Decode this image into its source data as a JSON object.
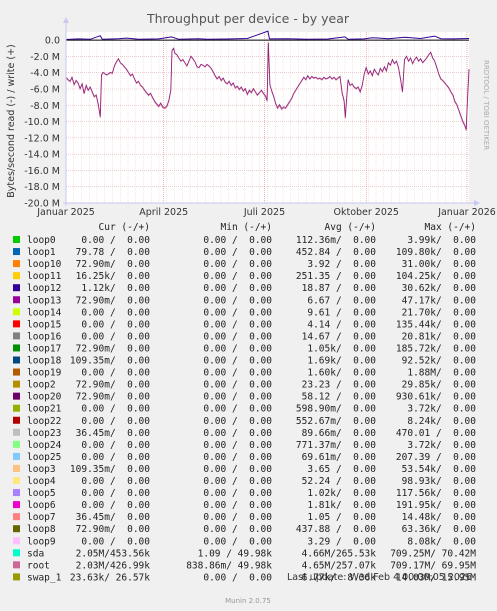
{
  "chart_data": {
    "type": "line",
    "title": "Throughput per device - by year",
    "ylabel": "Bytes/second read (-) / write (+)",
    "side_label": "RRDTOOL / TOBI OETIKER",
    "ylim": [
      -20000000,
      1000000
    ],
    "y_ticks": [
      {
        "v": 0,
        "label": "0.0"
      },
      {
        "v": -2000000,
        "label": "-2.0 M"
      },
      {
        "v": -4000000,
        "label": "-4.0 M"
      },
      {
        "v": -6000000,
        "label": "-6.0 M"
      },
      {
        "v": -8000000,
        "label": "-8.0 M"
      },
      {
        "v": -10000000,
        "label": "-10.0 M"
      },
      {
        "v": -12000000,
        "label": "-12.0 M"
      },
      {
        "v": -14000000,
        "label": "-14.0 M"
      },
      {
        "v": -16000000,
        "label": "-16.0 M"
      },
      {
        "v": -18000000,
        "label": "-18.0 M"
      },
      {
        "v": -20000000,
        "label": "-20.0 M"
      }
    ],
    "x_ticks": [
      {
        "t": 0.0,
        "label": "Januar 2025"
      },
      {
        "t": 0.2425,
        "label": "April 2025"
      },
      {
        "t": 0.4925,
        "label": "Juli 2025"
      },
      {
        "t": 0.745,
        "label": "Oktober 2025"
      },
      {
        "t": 0.995,
        "label": "Januar 2026"
      }
    ],
    "columns": [
      "",
      "Cur (-/+)",
      "Min (-/+)",
      "Avg (-/+)",
      "Max (-/+)"
    ],
    "series": [
      {
        "name": "loop0",
        "color": "#00cc00",
        "cur": "0.00 /  0.00",
        "min": "0.00 /  0.00",
        "avg": "112.36m/  0.00",
        "max": "3.99k/  0.00"
      },
      {
        "name": "loop1",
        "color": "#0066b3",
        "cur": "79.78 /  0.00",
        "min": "0.00 /  0.00",
        "avg": "452.84 /  0.00",
        "max": "109.80k/  0.00"
      },
      {
        "name": "loop10",
        "color": "#ff8000",
        "cur": "72.90m/  0.00",
        "min": "0.00 /  0.00",
        "avg": "3.92 /  0.00",
        "max": "31.00k/  0.00"
      },
      {
        "name": "loop11",
        "color": "#ffcc00",
        "cur": "16.25k/  0.00",
        "min": "0.00 /  0.00",
        "avg": "251.35 /  0.00",
        "max": "104.25k/  0.00"
      },
      {
        "name": "loop12",
        "color": "#330099",
        "cur": "1.12k/  0.00",
        "min": "0.00 /  0.00",
        "avg": "18.87 /  0.00",
        "max": "30.62k/  0.00"
      },
      {
        "name": "loop13",
        "color": "#990099",
        "cur": "72.90m/  0.00",
        "min": "0.00 /  0.00",
        "avg": "6.67 /  0.00",
        "max": "47.17k/  0.00"
      },
      {
        "name": "loop14",
        "color": "#ccff00",
        "cur": "0.00 /  0.00",
        "min": "0.00 /  0.00",
        "avg": "9.61 /  0.00",
        "max": "21.70k/  0.00"
      },
      {
        "name": "loop15",
        "color": "#ff0000",
        "cur": "0.00 /  0.00",
        "min": "0.00 /  0.00",
        "avg": "4.14 /  0.00",
        "max": "135.44k/  0.00"
      },
      {
        "name": "loop16",
        "color": "#808080",
        "cur": "0.00 /  0.00",
        "min": "0.00 /  0.00",
        "avg": "14.67 /  0.00",
        "max": "20.81k/  0.00"
      },
      {
        "name": "loop17",
        "color": "#008f00",
        "cur": "72.90m/  0.00",
        "min": "0.00 /  0.00",
        "avg": "1.05k/  0.00",
        "max": "185.72k/  0.00"
      },
      {
        "name": "loop18",
        "color": "#00487d",
        "cur": "109.35m/  0.00",
        "min": "0.00 /  0.00",
        "avg": "1.69k/  0.00",
        "max": "92.52k/  0.00"
      },
      {
        "name": "loop19",
        "color": "#b35a00",
        "cur": "0.00 /  0.00",
        "min": "0.00 /  0.00",
        "avg": "1.60k/  0.00",
        "max": "1.88M/  0.00"
      },
      {
        "name": "loop2",
        "color": "#b38f00",
        "cur": "72.90m/  0.00",
        "min": "0.00 /  0.00",
        "avg": "23.23 /  0.00",
        "max": "29.85k/  0.00"
      },
      {
        "name": "loop20",
        "color": "#6b006b",
        "cur": "72.90m/  0.00",
        "min": "0.00 /  0.00",
        "avg": "58.12 /  0.00",
        "max": "930.61k/  0.00"
      },
      {
        "name": "loop21",
        "color": "#8fb300",
        "cur": "0.00 /  0.00",
        "min": "0.00 /  0.00",
        "avg": "598.90m/  0.00",
        "max": "3.72k/  0.00"
      },
      {
        "name": "loop22",
        "color": "#b30000",
        "cur": "0.00 /  0.00",
        "min": "0.00 /  0.00",
        "avg": "552.67m/  0.00",
        "max": "8.24k/  0.00"
      },
      {
        "name": "loop23",
        "color": "#bebebe",
        "cur": "36.45m/  0.00",
        "min": "0.00 /  0.00",
        "avg": "89.66m/  0.00",
        "max": "470.01 /  0.00"
      },
      {
        "name": "loop24",
        "color": "#80ff80",
        "cur": "0.00 /  0.00",
        "min": "0.00 /  0.00",
        "avg": "771.37m/  0.00",
        "max": "3.72k/  0.00"
      },
      {
        "name": "loop25",
        "color": "#80c9ff",
        "cur": "0.00 /  0.00",
        "min": "0.00 /  0.00",
        "avg": "69.61m/  0.00",
        "max": "207.39 /  0.00"
      },
      {
        "name": "loop3",
        "color": "#ffc080",
        "cur": "109.35m/  0.00",
        "min": "0.00 /  0.00",
        "avg": "3.65 /  0.00",
        "max": "53.54k/  0.00"
      },
      {
        "name": "loop4",
        "color": "#ffe680",
        "cur": "0.00 /  0.00",
        "min": "0.00 /  0.00",
        "avg": "52.24 /  0.00",
        "max": "98.93k/  0.00"
      },
      {
        "name": "loop5",
        "color": "#aa80ff",
        "cur": "0.00 /  0.00",
        "min": "0.00 /  0.00",
        "avg": "1.02k/  0.00",
        "max": "117.56k/  0.00"
      },
      {
        "name": "loop6",
        "color": "#ee00cc",
        "cur": "0.00 /  0.00",
        "min": "0.00 /  0.00",
        "avg": "1.81k/  0.00",
        "max": "191.95k/  0.00"
      },
      {
        "name": "loop7",
        "color": "#ff8080",
        "cur": "36.45m/  0.00",
        "min": "0.00 /  0.00",
        "avg": "1.05 /  0.00",
        "max": "14.48k/  0.00"
      },
      {
        "name": "loop8",
        "color": "#666600",
        "cur": "72.90m/  0.00",
        "min": "0.00 /  0.00",
        "avg": "437.88 /  0.00",
        "max": "63.36k/  0.00"
      },
      {
        "name": "loop9",
        "color": "#ffbfff",
        "cur": "0.00 /  0.00",
        "min": "0.00 /  0.00",
        "avg": "3.29 /  0.00",
        "max": "8.08k/  0.00"
      },
      {
        "name": "sda",
        "color": "#00ffcc",
        "cur": "2.05M/453.56k",
        "min": "1.09 / 49.98k",
        "avg": "4.66M/265.53k",
        "max": "709.25M/ 70.42M"
      },
      {
        "name": "root",
        "color": "#cc6699",
        "cur": "2.03M/426.99k",
        "min": "838.86m/ 49.98k",
        "avg": "4.65M/257.07k",
        "max": "709.17M/ 69.95M"
      },
      {
        "name": "swap_1",
        "color": "#999900",
        "cur": "23.63k/ 26.57k",
        "min": "0.00 /  0.00",
        "avg": "6.77k/  8.36k",
        "max": "14.03M/ 15.95M"
      }
    ],
    "read_trace": [
      [
        0.0,
        -4.6
      ],
      [
        0.005,
        -4.9
      ],
      [
        0.01,
        -5.1
      ],
      [
        0.015,
        -4.6
      ],
      [
        0.02,
        -5.5
      ],
      [
        0.025,
        -5.0
      ],
      [
        0.03,
        -5.3
      ],
      [
        0.035,
        -6.0
      ],
      [
        0.04,
        -5.4
      ],
      [
        0.045,
        -6.6
      ],
      [
        0.05,
        -5.6
      ],
      [
        0.055,
        -6.2
      ],
      [
        0.06,
        -5.8
      ],
      [
        0.065,
        -6.4
      ],
      [
        0.07,
        -7.0
      ],
      [
        0.075,
        -6.8
      ],
      [
        0.08,
        -7.9
      ],
      [
        0.085,
        -9.5
      ],
      [
        0.088,
        -4.3
      ],
      [
        0.092,
        -4.0
      ],
      [
        0.095,
        -4.1
      ],
      [
        0.1,
        -4.3
      ],
      [
        0.105,
        -4.2
      ],
      [
        0.11,
        -4.0
      ],
      [
        0.115,
        -4.1
      ],
      [
        0.12,
        -3.2
      ],
      [
        0.125,
        -2.7
      ],
      [
        0.13,
        -2.3
      ],
      [
        0.135,
        -2.8
      ],
      [
        0.14,
        -3.0
      ],
      [
        0.145,
        -3.3
      ],
      [
        0.15,
        -3.6
      ],
      [
        0.155,
        -4.0
      ],
      [
        0.16,
        -4.4
      ],
      [
        0.165,
        -4.2
      ],
      [
        0.17,
        -4.8
      ],
      [
        0.175,
        -5.3
      ],
      [
        0.18,
        -5.1
      ],
      [
        0.185,
        -5.6
      ],
      [
        0.19,
        -5.8
      ],
      [
        0.195,
        -6.2
      ],
      [
        0.2,
        -6.5
      ],
      [
        0.205,
        -6.8
      ],
      [
        0.21,
        -6.6
      ],
      [
        0.215,
        -7.1
      ],
      [
        0.22,
        -7.6
      ],
      [
        0.225,
        -7.9
      ],
      [
        0.23,
        -8.2
      ],
      [
        0.235,
        -7.8
      ],
      [
        0.24,
        -8.3
      ],
      [
        0.245,
        -8.4
      ],
      [
        0.25,
        -8.2
      ],
      [
        0.255,
        -7.5
      ],
      [
        0.26,
        -6.2
      ],
      [
        0.263,
        -1.3
      ],
      [
        0.267,
        -1.0
      ],
      [
        0.27,
        -1.6
      ],
      [
        0.275,
        -1.8
      ],
      [
        0.28,
        -2.2
      ],
      [
        0.285,
        -2.6
      ],
      [
        0.29,
        -2.4
      ],
      [
        0.295,
        -2.8
      ],
      [
        0.3,
        -3.2
      ],
      [
        0.305,
        -2.6
      ],
      [
        0.31,
        -2.0
      ],
      [
        0.315,
        -2.3
      ],
      [
        0.32,
        -2.7
      ],
      [
        0.325,
        -3.3
      ],
      [
        0.33,
        -3.4
      ],
      [
        0.335,
        -3.0
      ],
      [
        0.34,
        -3.1
      ],
      [
        0.345,
        -3.3
      ],
      [
        0.35,
        -3.0
      ],
      [
        0.355,
        -3.2
      ],
      [
        0.36,
        -3.5
      ],
      [
        0.365,
        -3.9
      ],
      [
        0.37,
        -4.4
      ],
      [
        0.375,
        -4.8
      ],
      [
        0.38,
        -4.5
      ],
      [
        0.385,
        -5.0
      ],
      [
        0.39,
        -4.7
      ],
      [
        0.395,
        -5.2
      ],
      [
        0.4,
        -5.4
      ],
      [
        0.405,
        -5.1
      ],
      [
        0.41,
        -5.6
      ],
      [
        0.415,
        -5.3
      ],
      [
        0.42,
        -5.9
      ],
      [
        0.425,
        -5.7
      ],
      [
        0.43,
        -6.1
      ],
      [
        0.435,
        -5.8
      ],
      [
        0.44,
        -6.3
      ],
      [
        0.445,
        -6.0
      ],
      [
        0.45,
        -6.7
      ],
      [
        0.455,
        -6.2
      ],
      [
        0.46,
        -6.5
      ],
      [
        0.465,
        -6.0
      ],
      [
        0.47,
        -6.4
      ],
      [
        0.475,
        -6.8
      ],
      [
        0.48,
        -6.5
      ],
      [
        0.485,
        -6.2
      ],
      [
        0.49,
        -6.6
      ],
      [
        0.495,
        -6.9
      ],
      [
        0.499,
        -7.5
      ],
      [
        0.502,
        -0.3
      ],
      [
        0.506,
        -5.5
      ],
      [
        0.51,
        -6.2
      ],
      [
        0.515,
        -6.9
      ],
      [
        0.52,
        -7.8
      ],
      [
        0.525,
        -8.4
      ],
      [
        0.53,
        -8.0
      ],
      [
        0.535,
        -8.5
      ],
      [
        0.54,
        -8.3
      ],
      [
        0.545,
        -8.4
      ],
      [
        0.55,
        -8.0
      ],
      [
        0.555,
        -7.6
      ],
      [
        0.56,
        -7.2
      ],
      [
        0.565,
        -6.6
      ],
      [
        0.57,
        -6.2
      ],
      [
        0.575,
        -5.8
      ],
      [
        0.58,
        -5.4
      ],
      [
        0.585,
        -5.0
      ],
      [
        0.59,
        -4.6
      ],
      [
        0.595,
        -4.9
      ],
      [
        0.6,
        -4.4
      ],
      [
        0.605,
        -4.8
      ],
      [
        0.61,
        -4.5
      ],
      [
        0.615,
        -4.7
      ],
      [
        0.62,
        -4.6
      ],
      [
        0.625,
        -4.8
      ],
      [
        0.63,
        -4.7
      ],
      [
        0.635,
        -4.9
      ],
      [
        0.64,
        -4.6
      ],
      [
        0.645,
        -4.8
      ],
      [
        0.65,
        -4.7
      ],
      [
        0.655,
        -4.5
      ],
      [
        0.66,
        -4.8
      ],
      [
        0.665,
        -4.6
      ],
      [
        0.67,
        -4.9
      ],
      [
        0.675,
        -4.7
      ],
      [
        0.68,
        -4.5
      ],
      [
        0.685,
        -6.5
      ],
      [
        0.69,
        -7.5
      ],
      [
        0.693,
        -9.6
      ],
      [
        0.697,
        -6.8
      ],
      [
        0.7,
        -4.9
      ],
      [
        0.705,
        -5.6
      ],
      [
        0.71,
        -5.4
      ],
      [
        0.715,
        -5.8
      ],
      [
        0.72,
        -6.0
      ],
      [
        0.725,
        -5.8
      ],
      [
        0.73,
        -6.4
      ],
      [
        0.735,
        -5.6
      ],
      [
        0.74,
        -4.2
      ],
      [
        0.745,
        -3.4
      ],
      [
        0.75,
        -4.2
      ],
      [
        0.755,
        -3.8
      ],
      [
        0.76,
        -4.4
      ],
      [
        0.765,
        -3.6
      ],
      [
        0.77,
        -4.0
      ],
      [
        0.775,
        -4.3
      ],
      [
        0.78,
        -3.5
      ],
      [
        0.785,
        -3.9
      ],
      [
        0.79,
        -3.3
      ],
      [
        0.795,
        -3.8
      ],
      [
        0.8,
        -2.8
      ],
      [
        0.805,
        -3.1
      ],
      [
        0.81,
        -2.4
      ],
      [
        0.815,
        -2.9
      ],
      [
        0.82,
        -2.6
      ],
      [
        0.825,
        -3.4
      ],
      [
        0.83,
        -4.8
      ],
      [
        0.835,
        -6.4
      ],
      [
        0.84,
        -2.4
      ],
      [
        0.845,
        -2.0
      ],
      [
        0.85,
        -2.6
      ],
      [
        0.855,
        -2.2
      ],
      [
        0.86,
        -2.9
      ],
      [
        0.865,
        -2.4
      ],
      [
        0.87,
        -2.1
      ],
      [
        0.875,
        -2.6
      ],
      [
        0.88,
        -2.3
      ],
      [
        0.885,
        -2.8
      ],
      [
        0.89,
        -2.5
      ],
      [
        0.895,
        -2.2
      ],
      [
        0.9,
        -1.8
      ],
      [
        0.905,
        -1.5
      ],
      [
        0.91,
        -2.2
      ],
      [
        0.915,
        -2.6
      ],
      [
        0.92,
        -3.4
      ],
      [
        0.925,
        -4.2
      ],
      [
        0.93,
        -4.8
      ],
      [
        0.935,
        -5.0
      ],
      [
        0.94,
        -5.3
      ],
      [
        0.945,
        -5.6
      ],
      [
        0.95,
        -5.9
      ],
      [
        0.955,
        -6.4
      ],
      [
        0.96,
        -6.8
      ],
      [
        0.965,
        -7.6
      ],
      [
        0.97,
        -8.0
      ],
      [
        0.975,
        -8.7
      ],
      [
        0.98,
        -9.4
      ],
      [
        0.985,
        -10.1
      ],
      [
        0.99,
        -10.6
      ],
      [
        0.993,
        -11.1
      ],
      [
        0.996,
        -7.5
      ],
      [
        1.0,
        -3.6
      ]
    ],
    "write_trace": [
      [
        0.0,
        0.08
      ],
      [
        0.03,
        0.15
      ],
      [
        0.06,
        0.1
      ],
      [
        0.085,
        0.55
      ],
      [
        0.09,
        0.12
      ],
      [
        0.13,
        0.18
      ],
      [
        0.15,
        0.25
      ],
      [
        0.18,
        0.12
      ],
      [
        0.23,
        0.15
      ],
      [
        0.262,
        0.4
      ],
      [
        0.28,
        0.1
      ],
      [
        0.33,
        0.16
      ],
      [
        0.35,
        0.1
      ],
      [
        0.4,
        0.14
      ],
      [
        0.45,
        0.2
      ],
      [
        0.501,
        1.1
      ],
      [
        0.505,
        0.15
      ],
      [
        0.55,
        0.18
      ],
      [
        0.6,
        0.1
      ],
      [
        0.65,
        0.14
      ],
      [
        0.692,
        0.4
      ],
      [
        0.7,
        0.1
      ],
      [
        0.74,
        0.15
      ],
      [
        0.76,
        0.3
      ],
      [
        0.8,
        0.18
      ],
      [
        0.84,
        0.35
      ],
      [
        0.88,
        0.2
      ],
      [
        0.915,
        0.5
      ],
      [
        0.93,
        0.18
      ],
      [
        0.96,
        0.15
      ],
      [
        1.0,
        0.2
      ]
    ],
    "footer_update": "Last update: Wed Feb  4 00:00:05 2026",
    "footer_version": "Munin 2.0.75"
  }
}
